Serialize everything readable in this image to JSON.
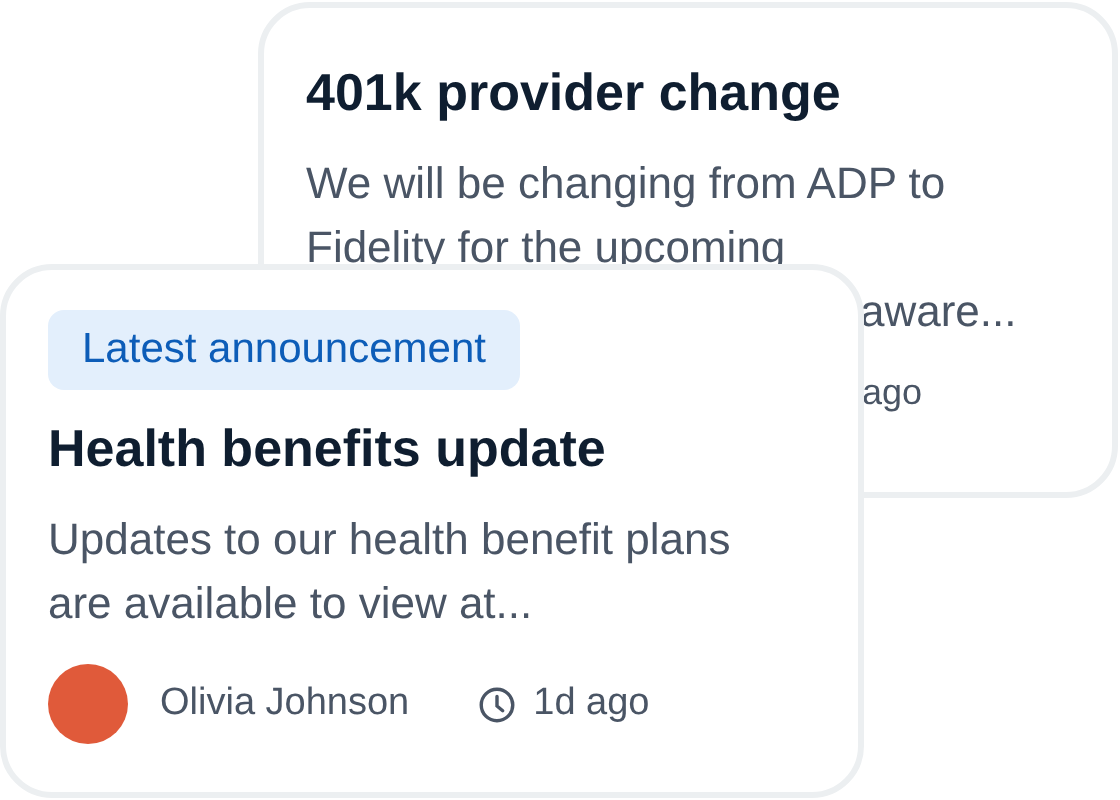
{
  "back_card": {
    "title": "401k provider change",
    "body_lines": [
      "We will be changing from ADP to",
      "Fidelity for the upcoming",
      "aware..."
    ],
    "time": "ago"
  },
  "front_card": {
    "badge": "Latest announcement",
    "title": "Health benefits update",
    "body": "Updates to our health benefit plans are available to view at...",
    "author": "Olivia Johnson",
    "time": "1d ago"
  }
}
